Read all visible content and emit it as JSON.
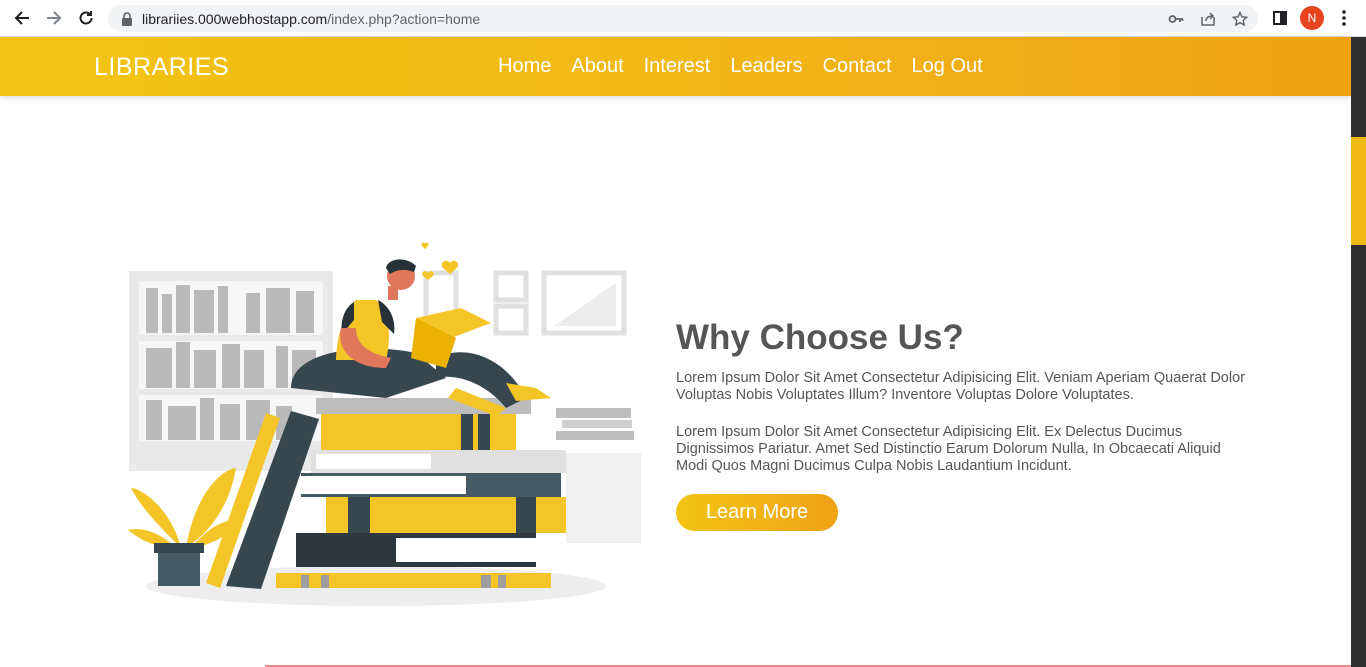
{
  "browser": {
    "url_host": "librariies.000webhostapp.com",
    "url_path": "/index.php?action=home",
    "profile_initial": "N",
    "icons": [
      "back-icon",
      "forward-icon",
      "reload-icon",
      "lock-icon",
      "key-icon",
      "share-icon",
      "star-icon",
      "sidepanel-icon",
      "menu-icon"
    ]
  },
  "header": {
    "logo": "LIBRARIES",
    "nav": [
      "Home",
      "About",
      "Interest",
      "Leaders",
      "Contact",
      "Log Out"
    ]
  },
  "main": {
    "title": "Why Choose Us?",
    "paragraph_1": "Lorem Ipsum Dolor Sit Amet Consectetur Adipisicing Elit. Veniam Aperiam Quaerat Dolor Voluptas Nobis Voluptates Illum? Inventore Voluptas Dolore Voluptates.",
    "paragraph_2": "Lorem Ipsum Dolor Sit Amet Consectetur Adipisicing Elit. Ex Delectus Ducimus Dignissimos Pariatur. Amet Sed Distinctio Earum Dolorum Nulla, In Obcaecati Aliquid Modi Quos Magni Ducimus Culpa Nobis Laudantium Incidunt.",
    "button": "Learn More"
  },
  "colors": {
    "accent": "#f1b816",
    "accent_dark": "#f0a215",
    "text": "#555555",
    "illustration_dark": "#37474f"
  }
}
